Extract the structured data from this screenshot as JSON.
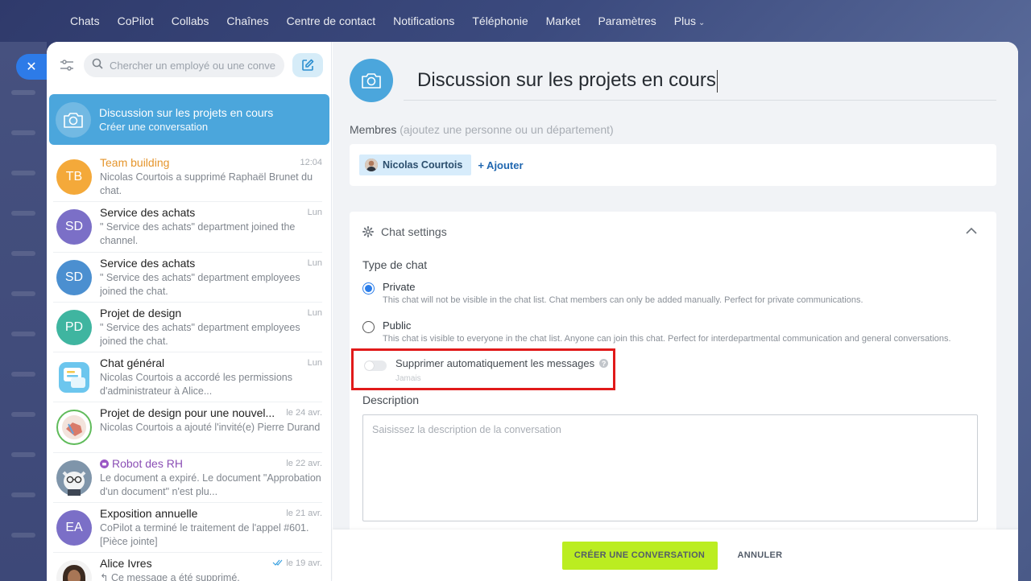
{
  "topnav": {
    "items": [
      "Chats",
      "CoPilot",
      "Collabs",
      "Chaînes",
      "Centre de contact",
      "Notifications",
      "Téléphonie",
      "Market",
      "Paramètres",
      "Plus"
    ]
  },
  "sidebar": {
    "search_placeholder": "Chercher un employé ou une conve",
    "active": {
      "title": "Discussion sur les projets en cours",
      "subtitle": "Créer une conversation"
    },
    "chats": [
      {
        "initials": "TB",
        "name": "Team building",
        "time": "12:04",
        "preview": "Nicolas Courtois a supprimé Raphaël Brunet du chat.",
        "color": "#f4a93a",
        "name_color": "#e5952c"
      },
      {
        "initials": "SD",
        "name": "Service des achats",
        "time": "Lun",
        "preview": "\" Service des achats\" department joined the channel.",
        "color": "#7b6fc7",
        "name_color": "#222"
      },
      {
        "initials": "SD",
        "name": "Service des achats",
        "time": "Lun",
        "preview": "\" Service des achats\" department employees joined the chat.",
        "color": "#4b8fd0",
        "name_color": "#222"
      },
      {
        "initials": "PD",
        "name": "Projet de design",
        "time": "Lun",
        "preview": "\" Service des achats\" department employees joined the chat.",
        "color": "#3fb5a0",
        "name_color": "#222"
      },
      {
        "initials": "",
        "name": "Chat général",
        "time": "Lun",
        "preview": "Nicolas Courtois a accordé les permissions d'administrateur à Alice...",
        "color": "#6cc6ee",
        "name_color": "#222"
      },
      {
        "initials": "",
        "name": "Projet de design pour une nouvel...",
        "time": "le 24 avr.",
        "preview": "Nicolas Courtois a ajouté l'invité(e) Pierre Durand",
        "color": "#e9f4e4",
        "name_color": "#222"
      },
      {
        "initials": "",
        "name": "Robot des RH",
        "time": "le 22 avr.",
        "preview": "Le document a expiré. Le document \"Approbation d'un document\" n'est plu...",
        "color": "#8fa3b7",
        "name_color": "#8b4fb5"
      },
      {
        "initials": "EA",
        "name": "Exposition annuelle",
        "time": "le 21 avr.",
        "preview": "CoPilot a terminé le traitement de l'appel #601. [Pièce jointe]",
        "color": "#7b6fc7",
        "name_color": "#222"
      },
      {
        "initials": "",
        "name": "Alice Ivres",
        "time": "le 19 avr.",
        "preview": "Ce message a été supprimé.",
        "color": "#5a4030",
        "name_color": "#222"
      }
    ]
  },
  "main": {
    "title": "Discussion sur les projets en cours",
    "members_label": "Membres",
    "members_hint": "(ajoutez une personne ou un département)",
    "member": "Nicolas Courtois",
    "add_label": "+ Ajouter",
    "settings_title": "Chat settings",
    "type_label": "Type de chat",
    "private_title": "Private",
    "private_desc": "This chat will not be visible in the chat list. Chat members can only be added manually. Perfect for private communications.",
    "public_title": "Public",
    "public_desc": "This chat is visible to everyone in the chat list. Anyone can join this chat. Perfect for interdepartmental communication and general conversations.",
    "autodelete_label": "Supprimer automatiquement les messages",
    "autodelete_value": "Jamais",
    "description_label": "Description",
    "description_placeholder": "Saisissez la description de la conversation"
  },
  "footer": {
    "create_label": "CRÉER UNE CONVERSATION",
    "cancel_label": "ANNULER"
  },
  "colors": {
    "accent": "#4ba6dc",
    "create_button": "#bbed21",
    "highlight_box": "#e11a1a",
    "radio_checked": "#2b7de9"
  }
}
